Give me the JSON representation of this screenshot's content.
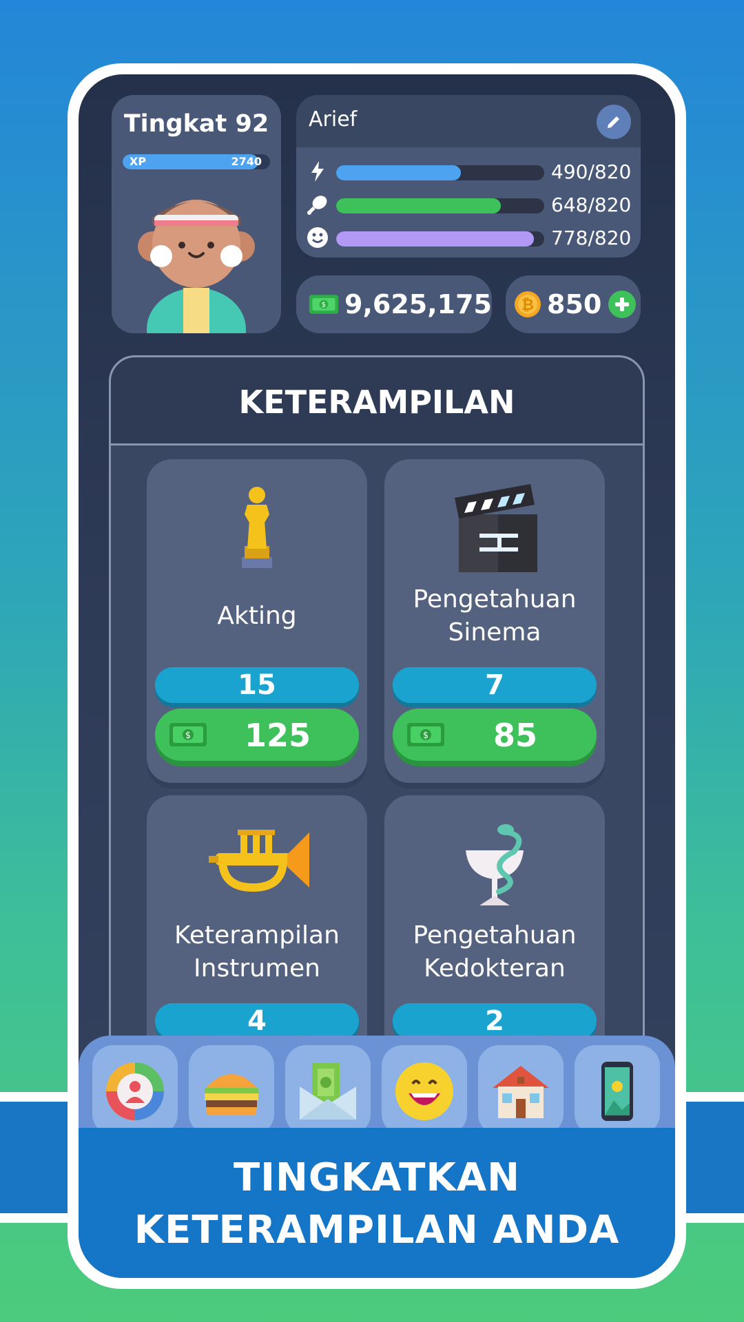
{
  "profile": {
    "level_label": "Tingkat 92",
    "xp_label": "XP",
    "xp_value": "2740",
    "xp_progress": 0.92
  },
  "stats": {
    "player_name": "Arief",
    "energy": {
      "text": "490/820",
      "progress": 0.598,
      "color": "#4ea3f1",
      "icon": "lightning-icon"
    },
    "hunger": {
      "text": "648/820",
      "progress": 0.79,
      "color": "#3ec15a",
      "icon": "chicken-leg-icon"
    },
    "happiness": {
      "text": "778/820",
      "progress": 0.949,
      "color": "#b199f5",
      "icon": "smile-face-icon"
    }
  },
  "currency": {
    "money": "9,625,175",
    "coins": "850"
  },
  "skills": {
    "title": "KETERAMPILAN",
    "items": [
      {
        "name_line1": "Akting",
        "name_line2": "",
        "level": "15",
        "price": "125",
        "icon": "trophy-statue-icon"
      },
      {
        "name_line1": "Pengetahuan",
        "name_line2": "Sinema",
        "level": "7",
        "price": "85",
        "icon": "clapperboard-icon"
      },
      {
        "name_line1": "Keterampilan",
        "name_line2": "Instrumen",
        "level": "4",
        "price": "",
        "icon": "trumpet-icon"
      },
      {
        "name_line1": "Pengetahuan",
        "name_line2": "Kedokteran",
        "level": "2",
        "price": "",
        "icon": "medicine-cup-snake-icon"
      }
    ]
  },
  "nav": [
    "profile-chart-icon",
    "burger-icon",
    "money-envelope-icon",
    "grin-face-icon",
    "house-icon",
    "smartphone-icon"
  ],
  "banner": {
    "line1": "TINGKATKAN",
    "line2": "KETERAMPILAN ANDA"
  },
  "colors": {
    "money_green": "#3ec15a",
    "level_blue": "#1ba3cf",
    "banner_blue": "#1575c6"
  }
}
